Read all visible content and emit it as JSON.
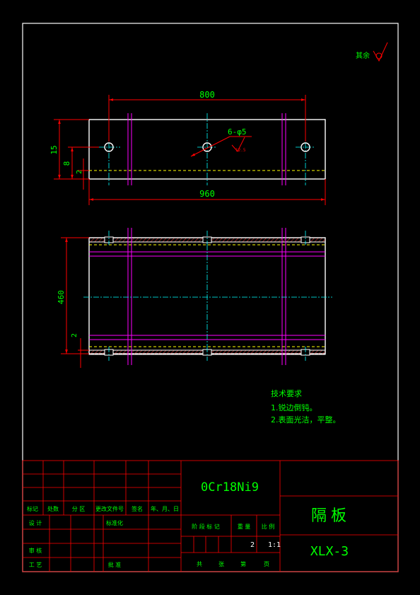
{
  "colors": {
    "background": "#000000",
    "frame": "#ffffff",
    "dimension": "#ff0000",
    "text": "#00ff00",
    "centerline": "#00ffff",
    "hidden": "#ffff00",
    "section": "#ff00ff"
  },
  "drawing": {
    "roughness_note": "其余",
    "dim_top_hole_spacing": "800",
    "dim_overall_length": "960",
    "dim_height_total": "15",
    "dim_height_hole": "8",
    "dim_height_offset": "2",
    "hole_callout": "6-φ5",
    "hole_roughness": "12.5",
    "dim_plan_height": "460",
    "dim_plan_offset": "2"
  },
  "notes": {
    "title": "技术要求",
    "item1": "1.锐边倒钝。",
    "item2": "2.表面光洁，平整。"
  },
  "title_block": {
    "material": "0Cr18Ni9",
    "part_name": "隔板",
    "drawing_number": "XLX-3",
    "header_labels": [
      "标记",
      "处数",
      "分 区",
      "更改文件号",
      "签名",
      "年、月、日"
    ],
    "row_design": "设 计",
    "row_standard": "标准化",
    "row_review": "审 核",
    "row_process": "工 艺",
    "row_approve": "批 准",
    "stage_label": "阶 段 标 记",
    "weight_label": "重 量",
    "scale_label": "比 例",
    "weight_value": "2",
    "scale_value": "1:1",
    "sheets_total": "共",
    "sheet_unit1": "张",
    "sheet_current": "第",
    "sheet_unit2": "页"
  }
}
